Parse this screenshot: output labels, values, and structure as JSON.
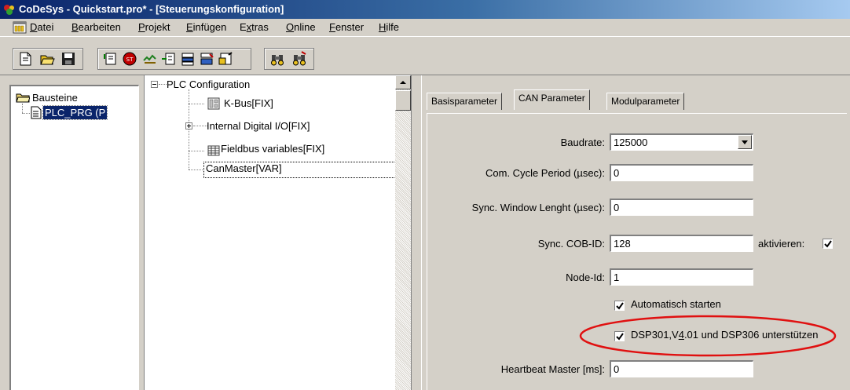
{
  "window": {
    "title": "CoDeSys - Quickstart.pro* - [Steuerungskonfiguration]"
  },
  "menu": {
    "items": [
      {
        "label": "Datei",
        "accel": "D"
      },
      {
        "label": "Bearbeiten",
        "accel": "B"
      },
      {
        "label": "Projekt",
        "accel": "P"
      },
      {
        "label": "Einfügen",
        "accel": "E"
      },
      {
        "label": "Extras",
        "accel": "x"
      },
      {
        "label": "Online",
        "accel": "O"
      },
      {
        "label": "Fenster",
        "accel": "F"
      },
      {
        "label": "Hilfe",
        "accel": "H"
      }
    ]
  },
  "toolbar": {
    "buttons": [
      "new-icon",
      "open-icon",
      "save-icon",
      "login-icon",
      "stop-icon",
      "run-icon",
      "step-icon",
      "toggle-breakpoint-icon",
      "write-values-icon",
      "force-values-icon",
      "find-icon",
      "replace-icon"
    ]
  },
  "object_organizer": {
    "root": "Bausteine",
    "item": "PLC_PRG (P"
  },
  "tree": {
    "root": "PLC Configuration",
    "nodes": [
      {
        "label": "K-Bus[FIX]",
        "icon": "module-icon"
      },
      {
        "label": "Internal Digital I/O[FIX]",
        "icon": "expand-icon"
      },
      {
        "label": "Fieldbus variables[FIX]",
        "icon": "grid-icon"
      },
      {
        "label": "CanMaster[VAR]",
        "icon": ""
      }
    ]
  },
  "tabs": [
    "Basisparameter",
    "CAN Parameter",
    "Modulparameter"
  ],
  "active_tab": "CAN Parameter",
  "form": {
    "baudrate_label": "Baudrate:",
    "baudrate_value": "125000",
    "cycle_label": "Com. Cycle Period (µsec):",
    "cycle_value": "0",
    "sync_window_label": "Sync. Window Lenght (µsec):",
    "sync_window_value": "0",
    "sync_cob_label": "Sync. COB-ID:",
    "sync_cob_value": "128",
    "aktivieren_label": "aktivieren:",
    "aktivieren_checked": true,
    "node_id_label": "Node-Id:",
    "node_id_value": "1",
    "autostart_label": "Automatisch starten",
    "autostart_checked": true,
    "dsp_label_a": "DSP301,V",
    "dsp_label_b": "4",
    "dsp_label_c": ".01 und DSP306 unterstützen",
    "dsp_checked": true,
    "heartbeat_label": "Heartbeat Master [ms]:",
    "heartbeat_value": "0"
  },
  "colors": {
    "titlebar_start": "#0a246a",
    "titlebar_end": "#a6caf0",
    "selection": "#0a246a",
    "highlight_ellipse": "#e01010"
  }
}
